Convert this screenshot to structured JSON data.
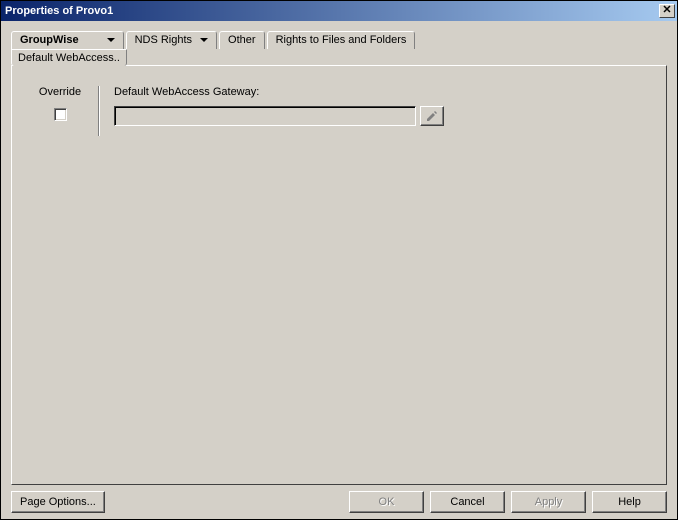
{
  "window": {
    "title": "Properties of Provo1"
  },
  "tabs": {
    "groupwise": "GroupWise",
    "nds": "NDS Rights",
    "other": "Other",
    "rights": "Rights to Files and Folders",
    "subtab": "Default WebAccess.."
  },
  "panel": {
    "override_label": "Override",
    "gateway_label": "Default WebAccess Gateway:",
    "gateway_value": ""
  },
  "buttons": {
    "page_options": "Page Options...",
    "ok": "OK",
    "cancel": "Cancel",
    "apply": "Apply",
    "help": "Help"
  }
}
